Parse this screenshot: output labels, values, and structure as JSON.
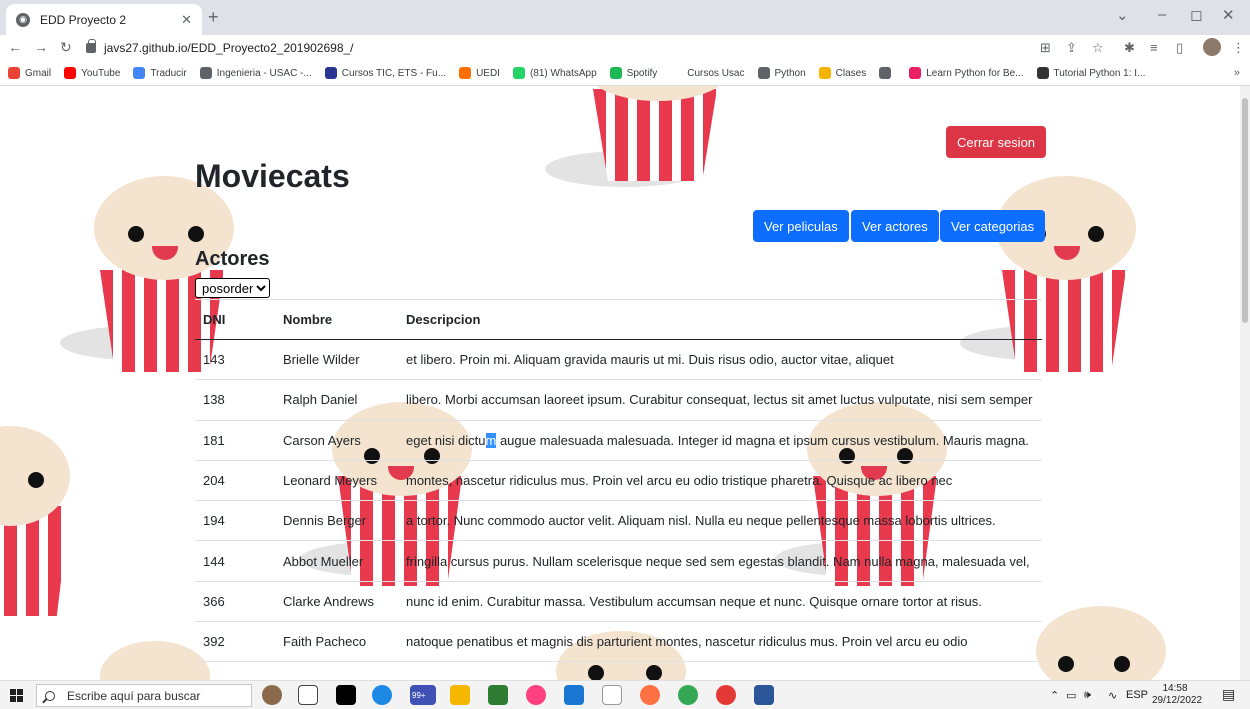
{
  "browser": {
    "tab_title": "EDD Proyecto 2",
    "url": "javs27.github.io/EDD_Proyecto2_201902698_/",
    "bookmarks": [
      {
        "label": "Gmail",
        "color": "#ea4335"
      },
      {
        "label": "YouTube",
        "color": "#ff0000"
      },
      {
        "label": "Traducir",
        "color": "#4285f4"
      },
      {
        "label": "Ingenieria - USAC -...",
        "color": "#5f6368"
      },
      {
        "label": "Cursos TIC, ETS - Fu...",
        "color": "#283593"
      },
      {
        "label": "UEDI",
        "color": "#ff6f00"
      },
      {
        "label": "(81) WhatsApp",
        "color": "#25d366"
      },
      {
        "label": "Spotify",
        "color": "#1db954"
      },
      {
        "label": "Cursos Usac",
        "color": "#ffffff"
      },
      {
        "label": "Python",
        "color": "#5f6368"
      },
      {
        "label": "Clases",
        "color": "#f4b400"
      },
      {
        "label": "",
        "color": "#5f6368"
      },
      {
        "label": "Learn Python for Be...",
        "color": "#e91e63"
      },
      {
        "label": "Tutorial Python 1: I...",
        "color": "#333333"
      }
    ],
    "bookmarks_more": "»"
  },
  "page": {
    "title": "Moviecats",
    "logout_label": "Cerrar sesion",
    "nav": {
      "movies_label": "Ver peliculas",
      "actors_label": "Ver actores",
      "categories_label": "Ver categorias"
    },
    "section_title": "Actores",
    "order_select": {
      "selected": "posorden"
    },
    "table": {
      "headers": [
        "DNI",
        "Nombre",
        "Descripcion"
      ],
      "rows": [
        {
          "dni": "143",
          "name": "Brielle Wilder",
          "desc": "et libero. Proin mi. Aliquam gravida mauris ut mi. Duis risus odio, auctor vitae, aliquet"
        },
        {
          "dni": "138",
          "name": "Ralph Daniel",
          "desc": "libero. Morbi accumsan laoreet ipsum. Curabitur consequat, lectus sit amet luctus vulputate, nisi sem semper"
        },
        {
          "dni": "181",
          "name": "Carson Ayers",
          "desc_before": "eget nisi dictu",
          "desc_selected": "m",
          "desc_after": " augue malesuada malesuada. Integer id magna et ipsum cursus vestibulum. Mauris magna."
        },
        {
          "dni": "204",
          "name": "Leonard Meyers",
          "desc": "montes, nascetur ridiculus mus. Proin vel arcu eu odio tristique pharetra. Quisque ac libero nec"
        },
        {
          "dni": "194",
          "name": "Dennis Berger",
          "desc": "a tortor. Nunc commodo auctor velit. Aliquam nisl. Nulla eu neque pellentesque massa lobortis ultrices."
        },
        {
          "dni": "144",
          "name": "Abbot Mueller",
          "desc": "fringilla cursus purus. Nullam scelerisque neque sed sem egestas blandit. Nam nulla magna, malesuada vel,"
        },
        {
          "dni": "366",
          "name": "Clarke Andrews",
          "desc": "nunc id enim. Curabitur massa. Vestibulum accumsan neque et nunc. Quisque ornare tortor at risus."
        },
        {
          "dni": "392",
          "name": "Faith Pacheco",
          "desc": "natoque penatibus et magnis dis parturient montes, nascetur ridiculus mus. Proin vel arcu eu odio"
        }
      ]
    }
  },
  "taskbar": {
    "search_placeholder": "Escribe aquí para buscar",
    "badge": "99+",
    "lang": "ESP",
    "time": "14:58",
    "date": "29/12/2022"
  },
  "colors": {
    "primary": "#0d6efd",
    "danger": "#dc3545",
    "popcorn_red": "#e8394d",
    "popcorn_cream": "#f3e3cf"
  }
}
